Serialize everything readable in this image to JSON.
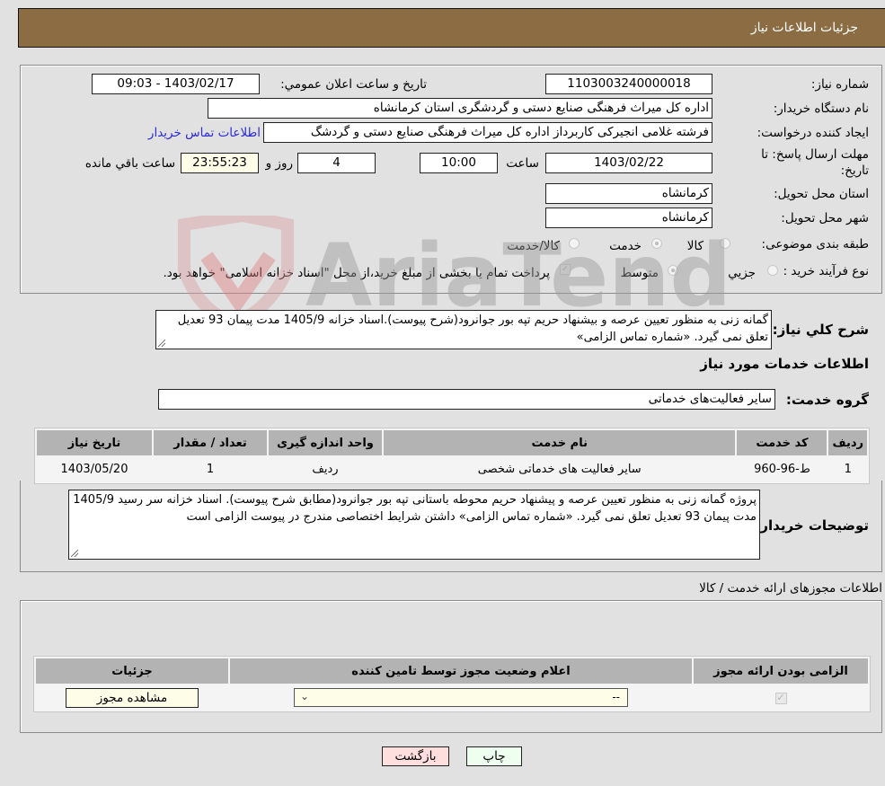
{
  "header": {
    "title": "جزئیات اطلاعات نیاز"
  },
  "details": {
    "need_number_label": "شماره نیاز:",
    "need_number": "1103003240000018",
    "announce_label": "تاريخ و ساعت اعلان عمومي:",
    "announce_value": "1403/02/17 - 09:03",
    "buyer_org_label": "نام دستگاه خریدار:",
    "buyer_org": "اداره کل میراث فرهنگی  صنایع دستی و گردشگری استان کرمانشاه",
    "creator_label": "ایجاد کننده درخواست:",
    "creator": "فرشته غلامی انجیرکی کاربرداز اداره کل میراث فرهنگی  صنایع دستی و گردشگ",
    "contact_link": "اطلاعات تماس خریدار",
    "deadline_label": "مهلت ارسال پاسخ: تا تاریخ:",
    "deadline_date": "1403/02/22",
    "time_label": "ساعت",
    "deadline_time": "10:00",
    "days": "4",
    "days_label": "روز و",
    "remaining": "23:55:23",
    "remaining_label": "ساعت باقي مانده",
    "province_label": "استان محل تحویل:",
    "province": "کرمانشاه",
    "city_label": "شهر محل تحویل:",
    "city": "کرمانشاه",
    "category_label": "طبقه بندی موضوعی:",
    "category_options": [
      "کالا",
      "خدمت",
      "کالا/خدمت"
    ],
    "category_selected": "خدمت",
    "process_label": "نوع فرآیند خرید :",
    "process_options": [
      "جزیي",
      "متوسط"
    ],
    "process_selected": "متوسط",
    "treasury_note": "پرداخت تمام یا بخشی از مبلغ خرید،از محل \"اسناد خزانه اسلامی\" خواهد بود."
  },
  "summary": {
    "label": "شرح کلي نياز:",
    "text": "گمانه زنی به منظور تعیین عرصه و بیشنهاد حریم  تپه بور جوانرود(شرح پیوست).اسناد خزانه  1405/9  مدت پیمان 93 تعدیل تعلق نمی گیرد. «شماره تماس الزامی»"
  },
  "services": {
    "section_title": "اطلاعات خدمات مورد نیاز",
    "group_label": "گروه خدمت:",
    "group_value": "سایر فعالیت‌های خدماتی",
    "columns": [
      "ردیف",
      "کد خدمت",
      "نام خدمت",
      "واحد اندازه گیری",
      "تعداد / مقدار",
      "تاریخ نیاز"
    ],
    "rows": [
      [
        "1",
        "ط-96-960",
        "سایر فعالیت های خدماتی شخصی",
        "ردیف",
        "1",
        "1403/05/20"
      ]
    ]
  },
  "buyer_notes": {
    "label": "توضیحات خریدار:",
    "text": "پروژه گمانه زنی به منظور تعیین عرصه و پیشنهاد حریم محوطه باستانی تپه بور جوانرود(مطابق شرح  پیوست). اسناد خزانه سر رسید 1405/9  مدت پیمان 93 تعدیل تعلق نمی گیرد. «شماره تماس الزامی» داشتن شرایط اختصاصی مندرج در پیوست الزامی است"
  },
  "permits": {
    "section_title": "اطلاعات مجوزهای ارائه خدمت / کالا",
    "columns": [
      "الزامی بودن ارائه مجوز",
      "اعلام وضعیت مجوز توسط تامین کننده",
      "جزئیات"
    ],
    "row": {
      "required": true,
      "status_value": "--",
      "details_button": "مشاهده مجوز"
    }
  },
  "footer": {
    "print_label": "چاپ",
    "back_label": "بازگشت"
  },
  "watermark": {
    "text": "AriaTender.neT"
  },
  "colors": {
    "header_bg": "#8c6d43",
    "link": "#2b2bd6",
    "print_bg": "#efffef",
    "back_bg": "#ffdede"
  }
}
